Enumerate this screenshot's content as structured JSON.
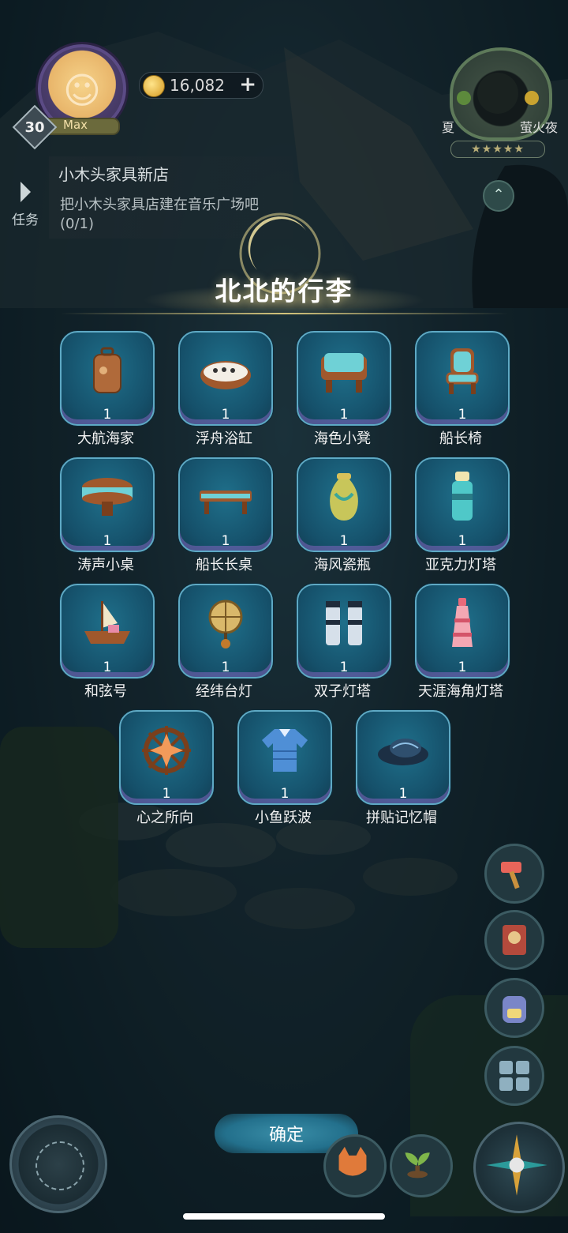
{
  "hud": {
    "level": "30",
    "level_max_label": "Max",
    "coins": "16,082",
    "coin_plus": "+",
    "season": "夏",
    "time_of_day": "萤火夜",
    "season_stars": "★★★★★"
  },
  "task": {
    "tab_label": "任务",
    "title": "小木头家具新店",
    "description": "把小木头家具店建在音乐广场吧",
    "progress": "(0/1)"
  },
  "dialog": {
    "title": "北北的行李",
    "items": [
      {
        "name": "大航海家",
        "count": "1",
        "icon": "suitcase-icon"
      },
      {
        "name": "浮舟浴缸",
        "count": "1",
        "icon": "bathtub-icon"
      },
      {
        "name": "海色小凳",
        "count": "1",
        "icon": "stool-icon"
      },
      {
        "name": "船长椅",
        "count": "1",
        "icon": "chair-icon"
      },
      {
        "name": "涛声小桌",
        "count": "1",
        "icon": "round-table-icon"
      },
      {
        "name": "船长长桌",
        "count": "1",
        "icon": "long-table-icon"
      },
      {
        "name": "海风瓷瓶",
        "count": "1",
        "icon": "vase-icon"
      },
      {
        "name": "亚克力灯塔",
        "count": "1",
        "icon": "lighthouse-icon"
      },
      {
        "name": "和弦号",
        "count": "1",
        "icon": "ship-icon"
      },
      {
        "name": "经纬台灯",
        "count": "1",
        "icon": "globe-lamp-icon"
      },
      {
        "name": "双子灯塔",
        "count": "1",
        "icon": "twin-lighthouse-icon"
      },
      {
        "name": "天涯海角灯塔",
        "count": "1",
        "icon": "pink-lighthouse-icon"
      },
      {
        "name": "心之所向",
        "count": "1",
        "icon": "ship-wheel-icon"
      },
      {
        "name": "小鱼跃波",
        "count": "1",
        "icon": "shirt-icon"
      },
      {
        "name": "拼贴记忆帽",
        "count": "1",
        "icon": "hat-icon"
      }
    ],
    "confirm_label": "确定"
  },
  "side_buttons": [
    "hammer-icon",
    "book-icon",
    "backpack-icon",
    "moon-grid-icon"
  ],
  "colors": {
    "slot_fill": "#15506a",
    "slot_border": "#5ea9c4",
    "slot_shadow": "#8264be",
    "title_glow": "#f0dc8c",
    "confirm_button": "#23708c"
  }
}
